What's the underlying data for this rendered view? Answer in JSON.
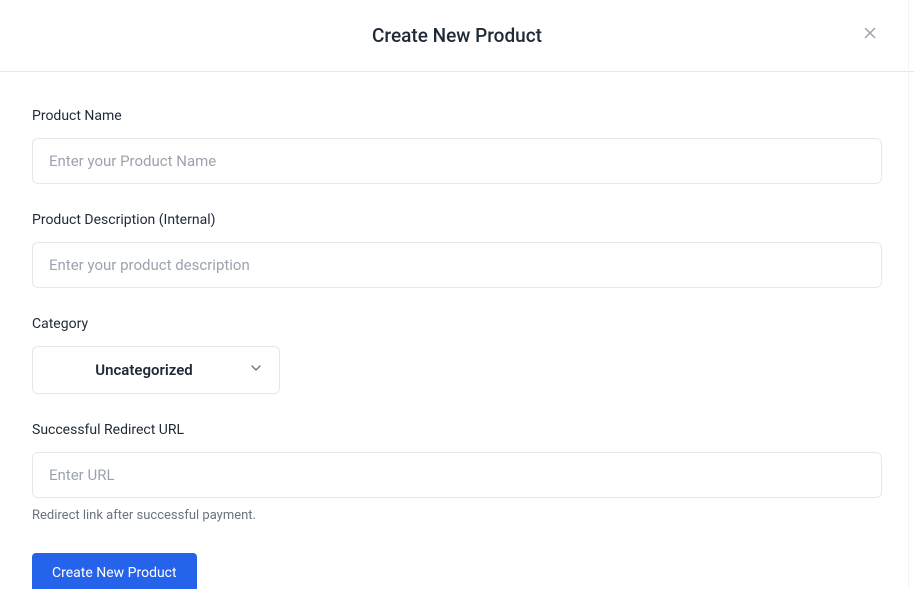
{
  "modal": {
    "title": "Create New Product"
  },
  "form": {
    "productName": {
      "label": "Product Name",
      "placeholder": "Enter your Product Name",
      "value": ""
    },
    "productDescription": {
      "label": "Product Description (Internal)",
      "placeholder": "Enter your product description",
      "value": ""
    },
    "category": {
      "label": "Category",
      "selected": "Uncategorized"
    },
    "redirectUrl": {
      "label": "Successful Redirect URL",
      "placeholder": "Enter URL",
      "value": "",
      "helpText": "Redirect link after successful payment."
    },
    "submitLabel": "Create New Product"
  }
}
